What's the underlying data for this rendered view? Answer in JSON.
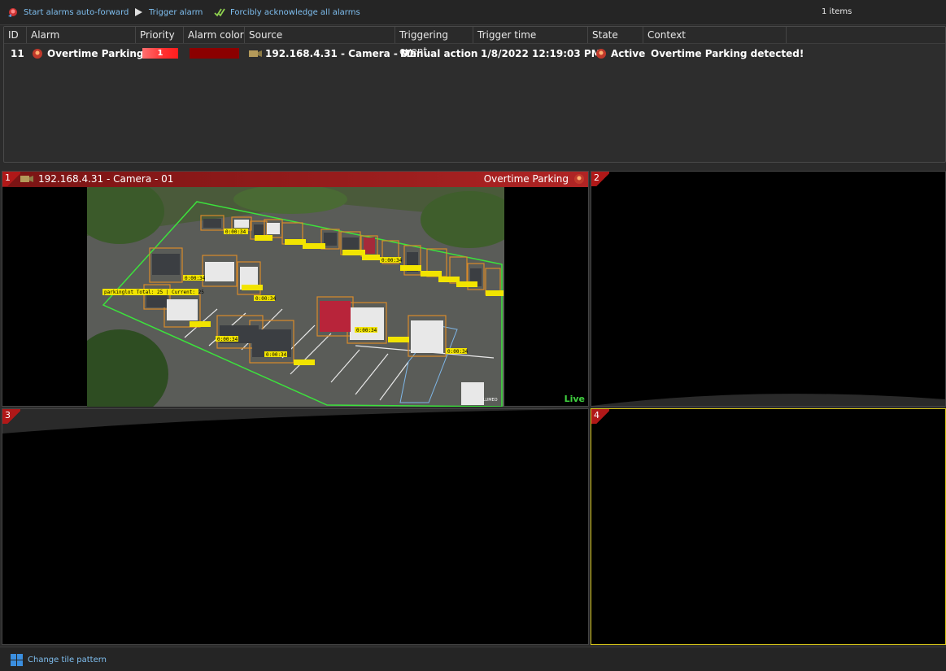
{
  "toolbar": {
    "auto_forward_label": "Start alarms auto-forward",
    "trigger_label": "Trigger alarm",
    "acknowledge_label": "Forcibly acknowledge all alarms",
    "items_count": "1 items"
  },
  "alarm_table": {
    "columns": [
      "ID",
      "Alarm",
      "Priority",
      "Alarm color",
      "Source",
      "Triggering event",
      "Trigger time",
      "State",
      "Context"
    ],
    "rows": [
      {
        "id": "11",
        "alarm": "Overtime Parking",
        "priority": "1",
        "alarm_color": "#8b0000",
        "source": "192.168.4.31 - Camera - 01",
        "triggering_event": "Manual action",
        "trigger_time": "1/8/2022 12:19:03 PM",
        "state": "Active",
        "context": "Overtime Parking detected!"
      }
    ]
  },
  "tiles": {
    "t1": {
      "number": "1",
      "camera": "192.168.4.31 - Camera - 01",
      "alarm": "Overtime Parking",
      "status": "Live"
    },
    "t2": {
      "number": "2"
    },
    "t3": {
      "number": "3"
    },
    "t4": {
      "number": "4"
    }
  },
  "video": {
    "overlay_text": "parkinglot Total: 25 | Current: 25",
    "timer_label": "0:00:34",
    "watermark": "LUMEO"
  },
  "bottombar": {
    "change_tile_label": "Change tile pattern"
  },
  "colors": {
    "accent": "#7fbff0",
    "alarm_red": "#b01818",
    "live_green": "#3fd13f",
    "selected_tile": "#d6c51a"
  }
}
